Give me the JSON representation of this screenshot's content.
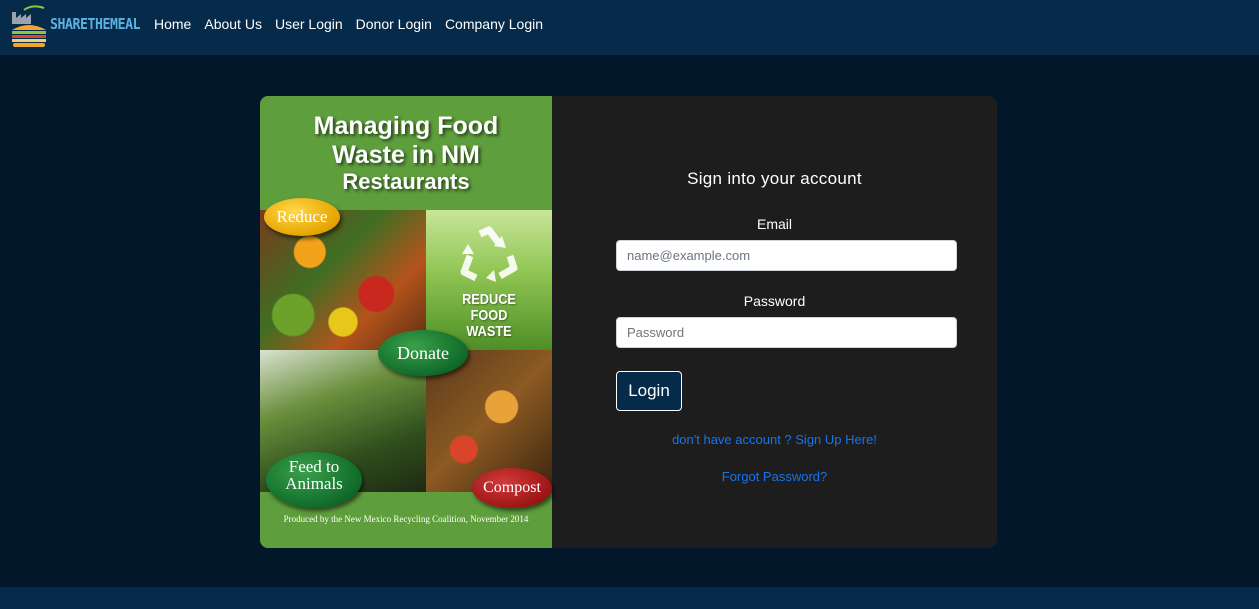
{
  "navbar": {
    "brand": "SHARETHEMEAL",
    "links": [
      "Home",
      "About Us",
      "User Login",
      "Donor Login",
      "Company Login"
    ]
  },
  "poster": {
    "title_line1": "Managing Food",
    "title_line2": "Waste in NM",
    "title_line3": "Restaurants",
    "reduce_food_waste": "REDUCE FOOD WASTE",
    "badge_reduce": "Reduce",
    "badge_donate": "Donate",
    "badge_feed": "Feed to Animals",
    "badge_compost": "Compost",
    "credit": "Produced by the New Mexico Recycling Coalition, November 2014"
  },
  "form": {
    "title": "Sign into your account",
    "email_label": "Email",
    "email_placeholder": "name@example.com",
    "email_value": "",
    "password_label": "Password",
    "password_placeholder": "Password",
    "password_value": "",
    "login_label": "Login",
    "signup_link": "don't have account ? Sign Up Here!",
    "forgot_link": "Forgot Password?"
  },
  "colors": {
    "page_bg": "#03172b",
    "navbar_bg": "#062a49",
    "card_bg": "#1d1d1d",
    "brand_color": "#5bb2e2",
    "link_color": "#1a73e8"
  }
}
